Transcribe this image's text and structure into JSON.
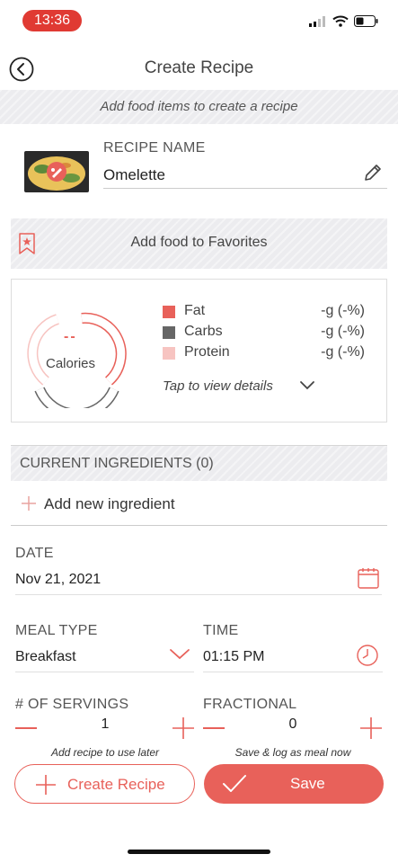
{
  "status_bar": {
    "time": "13:36"
  },
  "nav": {
    "title": "Create Recipe"
  },
  "hint": "Add food items to create a recipe",
  "recipe": {
    "name_label": "RECIPE NAME",
    "name_value": "Omelette"
  },
  "favorites": {
    "label": "Add food to Favorites"
  },
  "nutrition": {
    "calories_value": "--",
    "calories_label": "Calories",
    "macros": [
      {
        "name": "Fat",
        "value": "-g (-%)",
        "color": "#e8615a"
      },
      {
        "name": "Carbs",
        "value": "-g (-%)",
        "color": "#666666"
      },
      {
        "name": "Protein",
        "value": "-g (-%)",
        "color": "#f7c4c1"
      }
    ],
    "details_link": "Tap to view details"
  },
  "ingredients": {
    "header": "CURRENT INGREDIENTS (0)",
    "add_label": "Add new ingredient"
  },
  "date": {
    "label": "DATE",
    "value": "Nov 21, 2021"
  },
  "meal_type": {
    "label": "MEAL TYPE",
    "value": "Breakfast"
  },
  "time": {
    "label": "TIME",
    "value": "01:15 PM"
  },
  "servings": {
    "label": "# OF SERVINGS",
    "value": "1",
    "hint": "Add recipe to use later"
  },
  "fractional": {
    "label": "FRACTIONAL",
    "value": "0",
    "hint": "Save & log as meal now"
  },
  "buttons": {
    "create_label": "Create Recipe",
    "save_label": "Save"
  },
  "colors": {
    "accent": "#e8615a",
    "status_pill": "#e03a33"
  }
}
